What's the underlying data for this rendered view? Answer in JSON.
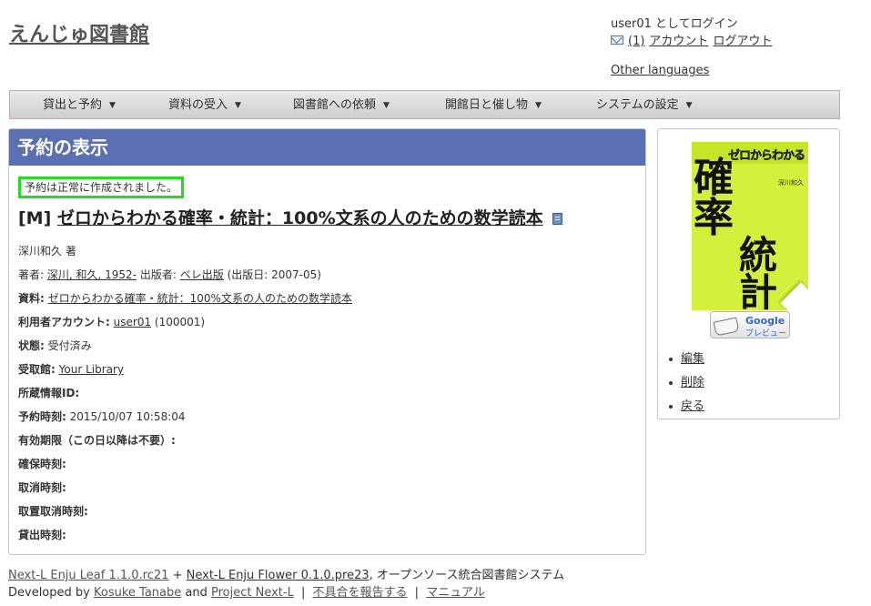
{
  "site": {
    "title": "えんじゅ図書館"
  },
  "user": {
    "login_text": "user01 としてログイン",
    "message_count": "(1)",
    "account_link": "アカウント",
    "logout_link": "ログアウト",
    "other_languages": "Other languages"
  },
  "nav": {
    "items": [
      {
        "label": "貸出と予約",
        "caret": "▼"
      },
      {
        "label": "資料の受入",
        "caret": "▼"
      },
      {
        "label": "図書館への依頼",
        "caret": "▼"
      },
      {
        "label": "開館日と催し物",
        "caret": "▼"
      },
      {
        "label": "システムの設定",
        "caret": "▼"
      }
    ]
  },
  "panel": {
    "header": "予約の表示",
    "notice": "予約は正常に作成されました。",
    "book": {
      "prefix": "[M]",
      "title": "ゼロからわかる確率・統計：100%文系の人のための数学読本"
    },
    "fields": {
      "statement": "深川和久 著",
      "author_label": "著者:",
      "author_value": "深川, 和久, 1952-",
      "publisher_label": "出版者:",
      "publisher_value": "ベレ出版",
      "pub_date": "(出版日: 2007-05)",
      "resource_label": "資料:",
      "resource_value": "ゼロからわかる確率・統計：100%文系の人のための数学読本",
      "user_label": "利用者アカウント:",
      "user_value": "user01",
      "user_number": "(100001)",
      "state_label": "状態:",
      "state_value": "受付済み",
      "pickup_label": "受取館:",
      "pickup_value": "Your Library",
      "item_id_label": "所蔵情報ID:",
      "reserved_label": "予約時刻:",
      "reserved_value": "2015/10/07 10:58:04",
      "expire_label": "有効期限（この日以降は不要）:",
      "retained_label": "確保時刻:",
      "canceled_label": "取消時刻:",
      "retain_cancel_label": "取置取消時刻:",
      "checkout_label": "貸出時刻:"
    }
  },
  "sidebar": {
    "cover": {
      "kicker": "ゼロからわかる",
      "big1": "確",
      "big2": "率",
      "big3": "統",
      "big4": "計",
      "author": "深川和久"
    },
    "preview": {
      "brand": "Google",
      "label": "プレビュー"
    },
    "links": [
      "編集",
      "削除",
      "戻る"
    ]
  },
  "footer": {
    "leaf": "Next-L Enju Leaf 1.1.0.rc21",
    "plus": "+",
    "flower": "Next-L Enju Flower 0.1.0.pre23",
    "tagline": ", オープンソース統合図書館システム",
    "developed_by": "Developed by",
    "dev_name": "Kosuke Tanabe",
    "and": "and",
    "project": "Project Next-L",
    "sep": "|",
    "report": "不具合を報告する",
    "manual": "マニュアル"
  },
  "colors": {
    "header_bg": "#5b6fb3",
    "notice_border": "#22dd22",
    "cover_bg": "#d4f03c"
  }
}
